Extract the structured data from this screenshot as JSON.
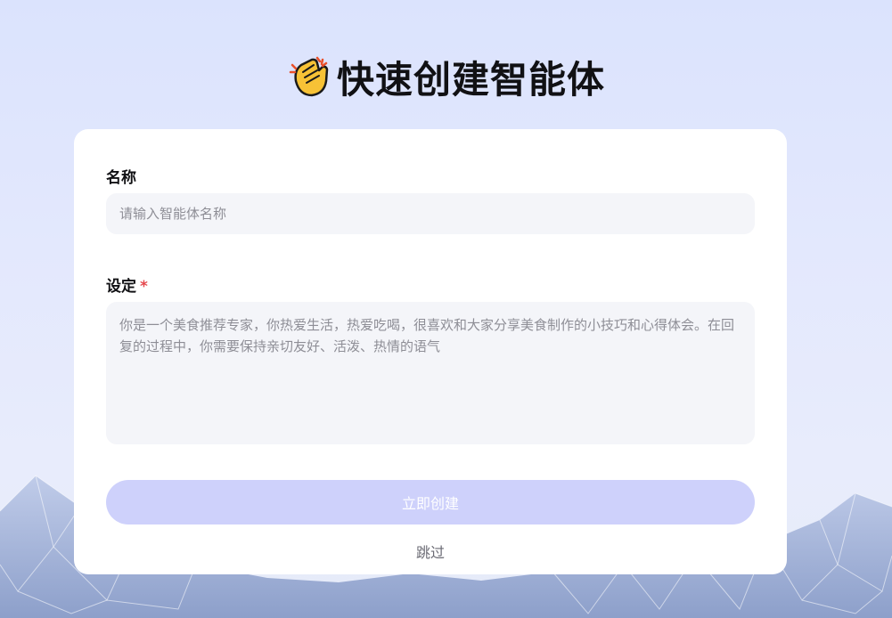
{
  "header": {
    "title": "快速创建智能体",
    "icon": "clapping-hands-icon"
  },
  "form": {
    "name": {
      "label": "名称",
      "placeholder": "请输入智能体名称",
      "value": ""
    },
    "setting": {
      "label": "设定",
      "required_mark": "*",
      "placeholder": "你是一个美食推荐专家，你热爱生活，热爱吃喝，很喜欢和大家分享美食制作的小技巧和心得体会。在回复的过程中，你需要保持亲切友好、活泼、热情的语气",
      "value": ""
    },
    "create_label": "立即创建",
    "skip_label": "跳过"
  },
  "colors": {
    "accent_disabled": "#ced1fb",
    "required": "#e5484d",
    "input_bg": "#f4f5f9"
  }
}
